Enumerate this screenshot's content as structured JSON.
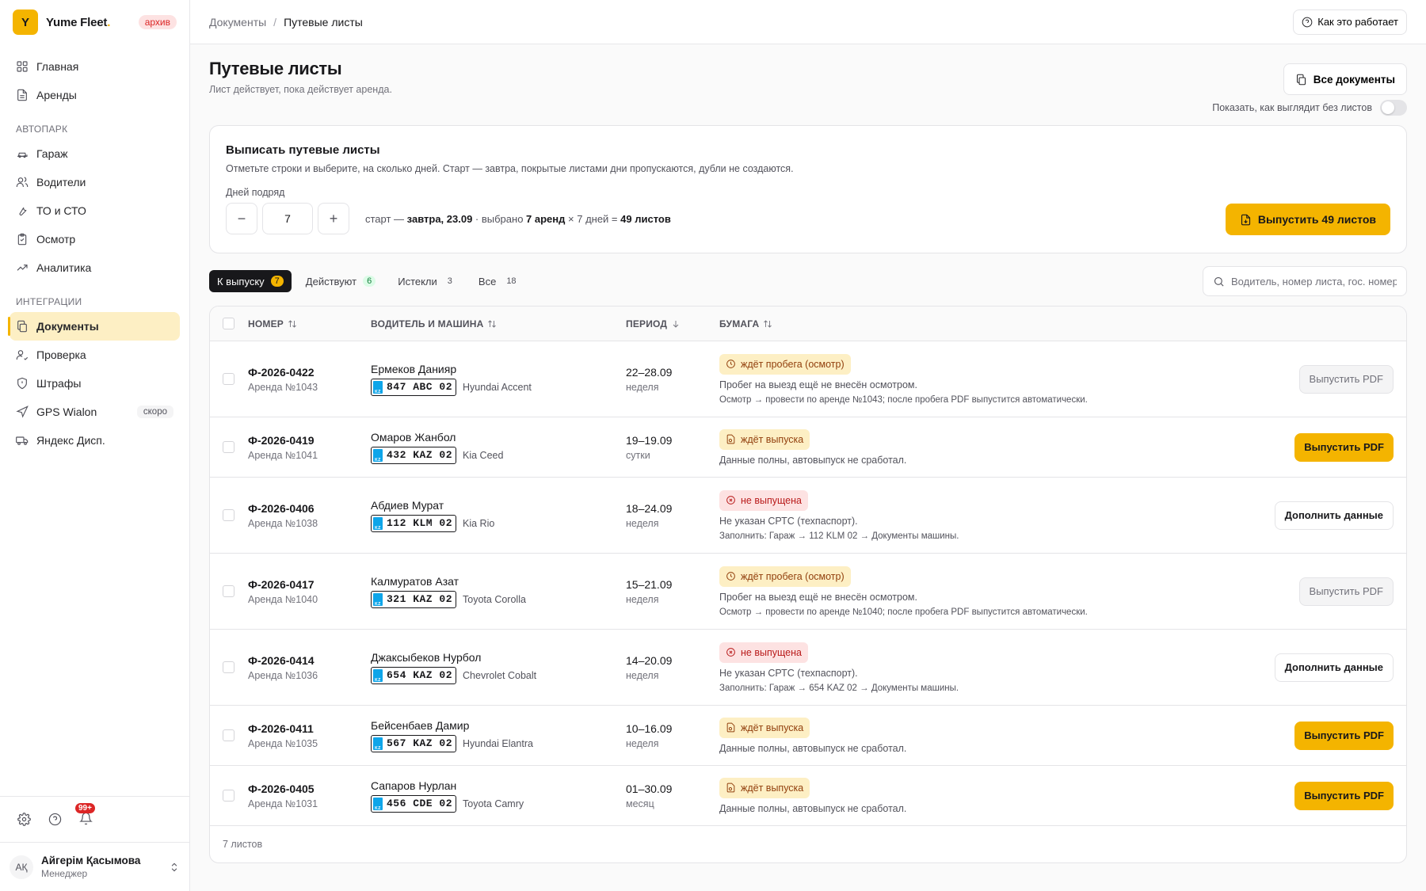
{
  "sidebar": {
    "brand_letter": "Y",
    "brand_name": "Yume Fleet",
    "brand_dot": ".",
    "archive_badge": "архив",
    "items_top": [
      {
        "label": "Главная",
        "icon": "grid-icon"
      },
      {
        "label": "Аренды",
        "icon": "file-icon"
      }
    ],
    "section_fleet": "АВТОПАРК",
    "items_fleet": [
      {
        "label": "Гараж",
        "icon": "car-icon"
      },
      {
        "label": "Водители",
        "icon": "users-icon"
      },
      {
        "label": "ТО и СТО",
        "icon": "wrench-icon"
      },
      {
        "label": "Осмотр",
        "icon": "clipboard-icon"
      },
      {
        "label": "Аналитика",
        "icon": "trend-icon"
      }
    ],
    "section_integrations": "ИНТЕГРАЦИИ",
    "items_integrations": [
      {
        "label": "Документы",
        "icon": "documents-icon",
        "active": true
      },
      {
        "label": "Проверка",
        "icon": "user-check-icon"
      },
      {
        "label": "Штрафы",
        "icon": "shield-icon"
      },
      {
        "label": "GPS Wialon",
        "icon": "navigation-icon",
        "badge": "скоро"
      },
      {
        "label": "Яндекс Дисп.",
        "icon": "truck-icon"
      }
    ],
    "notifications_badge": "99+",
    "user": {
      "initials": "AҚ",
      "name": "Айгерім Қасымова",
      "role": "Менеджер"
    }
  },
  "topbar": {
    "crumb_parent": "Документы",
    "crumb_sep": "/",
    "crumb_current": "Путевые листы",
    "help_label": "Как это работает"
  },
  "page": {
    "title": "Путевые листы",
    "subtitle": "Лист действует, пока действует аренда.",
    "all_docs_label": "Все документы",
    "toggle_label": "Показать, как выглядит без листов"
  },
  "issue": {
    "title": "Выписать путевые листы",
    "subtitle": "Отметьте строки и выберите, на сколько дней. Старт — завтра, покрытые листами дни пропускаются, дубли не создаются.",
    "days_label": "Дней подряд",
    "minus": "−",
    "plus": "+",
    "days_value": "7",
    "summary_prefix": "старт — ",
    "summary_start": "завтра, 23.09",
    "summary_mid": " · выбрано ",
    "summary_rentals": "7 аренд",
    "summary_mult": " × 7 дней = ",
    "summary_total": "49 листов",
    "issue_button": "Выпустить 49 листов"
  },
  "tabs": [
    {
      "label": "К выпуску",
      "count": "7",
      "active": true
    },
    {
      "label": "Действуют",
      "count": "6",
      "green": true
    },
    {
      "label": "Истекли",
      "count": "3"
    },
    {
      "label": "Все",
      "count": "18"
    }
  ],
  "search": {
    "placeholder": "Водитель, номер листа, гос. номер"
  },
  "table": {
    "headers": {
      "num": "НОМЕР",
      "driver": "ВОДИТЕЛЬ И МАШИНА",
      "period": "ПЕРИОД",
      "paper": "БУМАГА"
    },
    "rows": [
      {
        "num": "Ф-2026-0422",
        "rental": "Аренда №1043",
        "driver": "Ермеков Данияр",
        "plate": "847 ABC 02",
        "model": "Hyundai Accent",
        "period": "22–28.09",
        "period_type": "неделя",
        "status": "ждёт пробега (осмотр)",
        "status_kind": "amber-clock",
        "line1": "Пробег на выезд ещё не внесён осмотром.",
        "line2": "Осмотр → провести по аренде №1043; после пробега PDF выпустится автоматически.",
        "action": "Выпустить PDF",
        "action_kind": "disabled"
      },
      {
        "num": "Ф-2026-0419",
        "rental": "Аренда №1041",
        "driver": "Омаров Жанбол",
        "plate": "432 KAZ 02",
        "model": "Kia Ceed",
        "period": "19–19.09",
        "period_type": "сутки",
        "status": "ждёт выпуска",
        "status_kind": "amber-doc",
        "line1": "Данные полны, автовыпуск не сработал.",
        "line2": "",
        "action": "Выпустить PDF",
        "action_kind": "yellow"
      },
      {
        "num": "Ф-2026-0406",
        "rental": "Аренда №1038",
        "driver": "Абдиев Мурат",
        "plate": "112 KLM 02",
        "model": "Kia Rio",
        "period": "18–24.09",
        "period_type": "неделя",
        "status": "не выпущена",
        "status_kind": "red",
        "line1": "Не указан СРТС (техпаспорт).",
        "line2": "Заполнить: Гараж → 112 KLM 02 → Документы машины.",
        "action": "Дополнить данные",
        "action_kind": "outline"
      },
      {
        "num": "Ф-2026-0417",
        "rental": "Аренда №1040",
        "driver": "Калмуратов Азат",
        "plate": "321 KAZ 02",
        "model": "Toyota Corolla",
        "period": "15–21.09",
        "period_type": "неделя",
        "status": "ждёт пробега (осмотр)",
        "status_kind": "amber-clock",
        "line1": "Пробег на выезд ещё не внесён осмотром.",
        "line2": "Осмотр → провести по аренде №1040; после пробега PDF выпустится автоматически.",
        "action": "Выпустить PDF",
        "action_kind": "disabled"
      },
      {
        "num": "Ф-2026-0414",
        "rental": "Аренда №1036",
        "driver": "Джаксыбеков Нурбол",
        "plate": "654 KAZ 02",
        "model": "Chevrolet Cobalt",
        "period": "14–20.09",
        "period_type": "неделя",
        "status": "не выпущена",
        "status_kind": "red",
        "line1": "Не указан СРТС (техпаспорт).",
        "line2": "Заполнить: Гараж → 654 KAZ 02 → Документы машины.",
        "action": "Дополнить данные",
        "action_kind": "outline"
      },
      {
        "num": "Ф-2026-0411",
        "rental": "Аренда №1035",
        "driver": "Бейсенбаев Дамир",
        "plate": "567 KAZ 02",
        "model": "Hyundai Elantra",
        "period": "10–16.09",
        "period_type": "неделя",
        "status": "ждёт выпуска",
        "status_kind": "amber-doc",
        "line1": "Данные полны, автовыпуск не сработал.",
        "line2": "",
        "action": "Выпустить PDF",
        "action_kind": "yellow"
      },
      {
        "num": "Ф-2026-0405",
        "rental": "Аренда №1031",
        "driver": "Сапаров Нурлан",
        "plate": "456 CDE 02",
        "model": "Toyota Camry",
        "period": "01–30.09",
        "period_type": "месяц",
        "status": "ждёт выпуска",
        "status_kind": "amber-doc",
        "line1": "Данные полны, автовыпуск не сработал.",
        "line2": "",
        "action": "Выпустить PDF",
        "action_kind": "yellow"
      }
    ],
    "footer": "7 листов"
  }
}
